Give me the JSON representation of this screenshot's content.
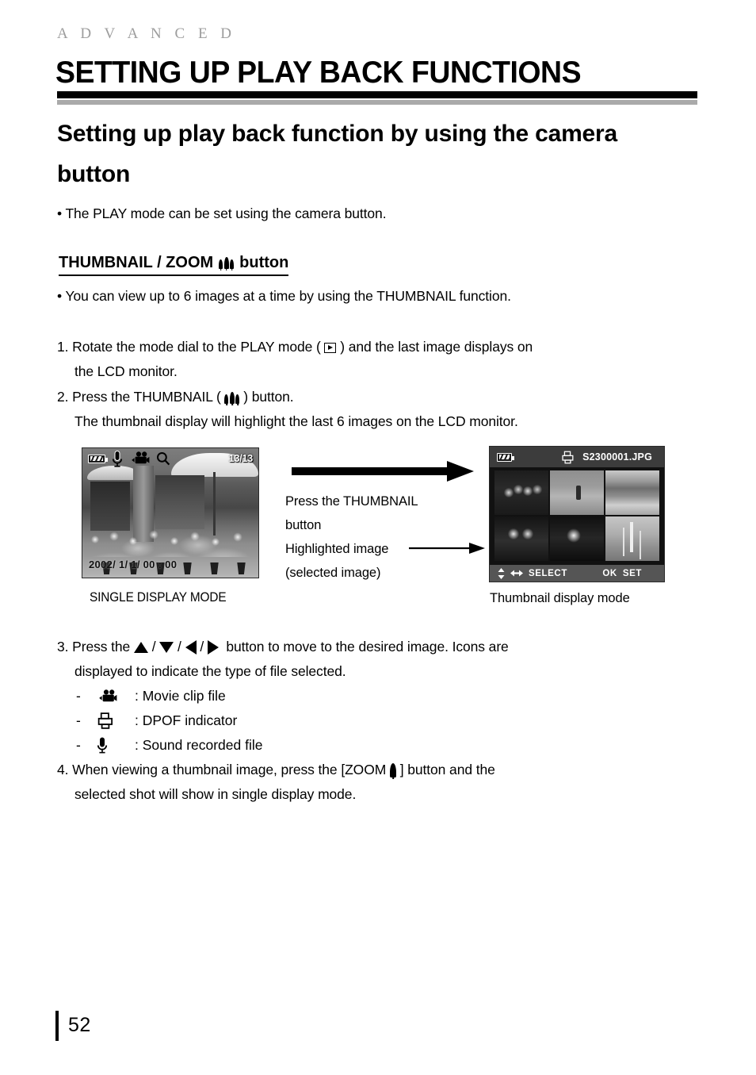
{
  "header": {
    "kicker": "A D V A N C E D",
    "title": "SETTING UP PLAY BACK FUNCTIONS"
  },
  "section": {
    "heading": "Setting up play back function by using the camera button",
    "bullet_1": "• The PLAY mode can be set using the camera button.",
    "sub_heading_pre": "THUMBNAIL / ZOOM",
    "sub_heading_post": "button",
    "bullet_2": "• You can view up to 6 images at a time by using the THUMBNAIL function."
  },
  "steps": {
    "s1_a": "1. Rotate the mode dial to the PLAY mode (",
    "s1_b": ") and the last image displays on",
    "s1_c": "the LCD monitor.",
    "s2_a": "2. Press the THUMBNAIL (",
    "s2_b": ") button.",
    "s2_c": "The thumbnail display will highlight the last 6 images on the LCD monitor.",
    "s3_a": "3. Press the",
    "s3_sep1": "/",
    "s3_sep2": "/",
    "s3_sep3": "/",
    "s3_b": "button to move to the desired image. Icons are",
    "s3_c": "displayed to indicate the type of file selected.",
    "s4_a": "4. When viewing a thumbnail image, press the [ZOOM",
    "s4_b": "] button and the",
    "s4_c": "selected shot will show in single display mode."
  },
  "icon_legend": [
    {
      "dash": "-",
      "icon": "movie-clip-icon",
      "label": ": Movie clip file"
    },
    {
      "dash": "-",
      "icon": "dpof-icon",
      "label": ": DPOF indicator"
    },
    {
      "dash": "-",
      "icon": "microphone-icon",
      "label": ": Sound recorded file"
    }
  ],
  "figure_single": {
    "counter": "13/13",
    "timestamp": "2002/  1/  1/ 00 : 00",
    "caption": "SINGLE DISPLAY MODE",
    "osd_icons": [
      "battery-icon",
      "microphone-icon",
      "movie-clip-icon",
      "magnifier-icon"
    ]
  },
  "figure_thumbnail": {
    "filename": "S2300001.JPG",
    "caption": "Thumbnail display mode",
    "top_icons": [
      "battery-icon",
      "dpof-icon"
    ],
    "bottom_select": "SELECT",
    "bottom_ok": "OK",
    "bottom_set": "SET",
    "cells": [
      {
        "name": "group-photo",
        "selected": false
      },
      {
        "name": "hiker-photo",
        "selected": false
      },
      {
        "name": "lake-photo",
        "selected": false
      },
      {
        "name": "two-people-photo",
        "selected": true
      },
      {
        "name": "smiling-woman-photo",
        "selected": false
      },
      {
        "name": "dead-tree-photo",
        "selected": false
      }
    ]
  },
  "annotation": {
    "line1": "Press the THUMBNAIL",
    "line2": "button",
    "line3": "Highlighted image",
    "line4": "(selected image)"
  },
  "footer": {
    "page_number": "52"
  },
  "colors": {
    "rule_black": "#000000",
    "rule_gray": "#aaaaaa",
    "kicker_gray": "#9d9d9d",
    "osd_bar": "#3c3c3c",
    "osd_bottom_bar": "#555555",
    "selection": "#ffffff"
  }
}
